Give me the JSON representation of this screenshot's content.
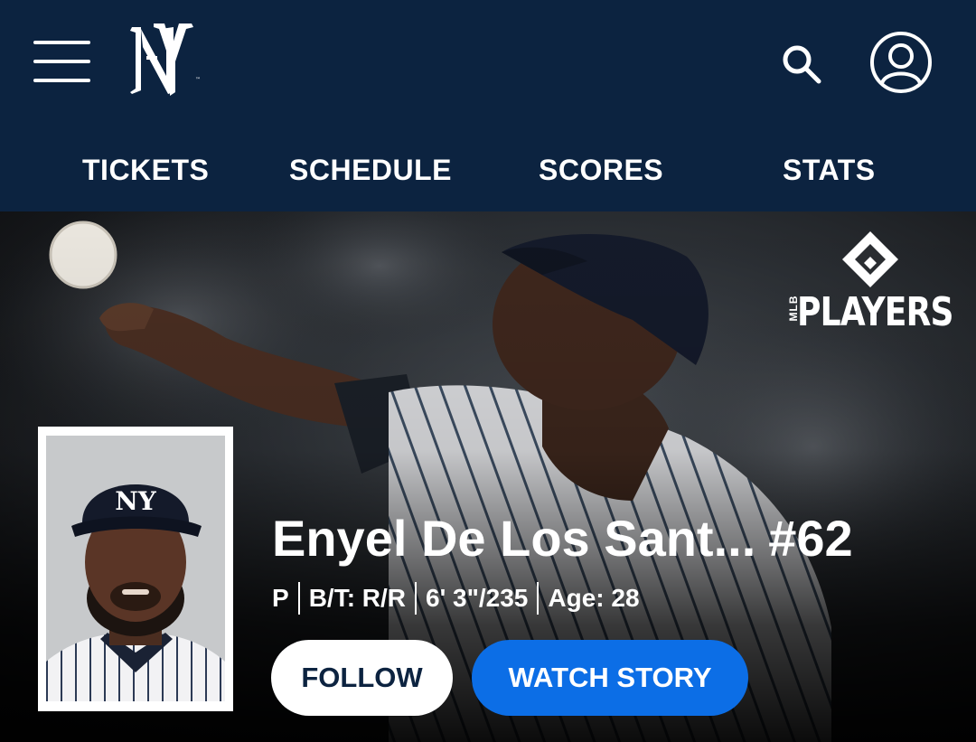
{
  "header": {
    "menu_icon": "hamburger-menu-icon",
    "logo": "yankees-ny-logo",
    "search_icon": "search-icon",
    "account_icon": "user-account-icon"
  },
  "nav": {
    "items": [
      {
        "label": "TICKETS"
      },
      {
        "label": "SCHEDULE"
      },
      {
        "label": "SCORES"
      },
      {
        "label": "STATS"
      }
    ]
  },
  "hero": {
    "partner_logo_text": "PLAYERS",
    "partner_logo_prefix": "MLB",
    "player": {
      "name": "Enyel De Los Sant...",
      "number": "#62",
      "position": "P",
      "bats_throws": "B/T: R/R",
      "height_weight": "6' 3\"/235",
      "age": "Age: 28"
    },
    "buttons": {
      "follow": "FOLLOW",
      "watch_story": "WATCH STORY"
    }
  },
  "colors": {
    "navy": "#0c2340",
    "accent_blue": "#0c6ee6",
    "white": "#ffffff"
  }
}
